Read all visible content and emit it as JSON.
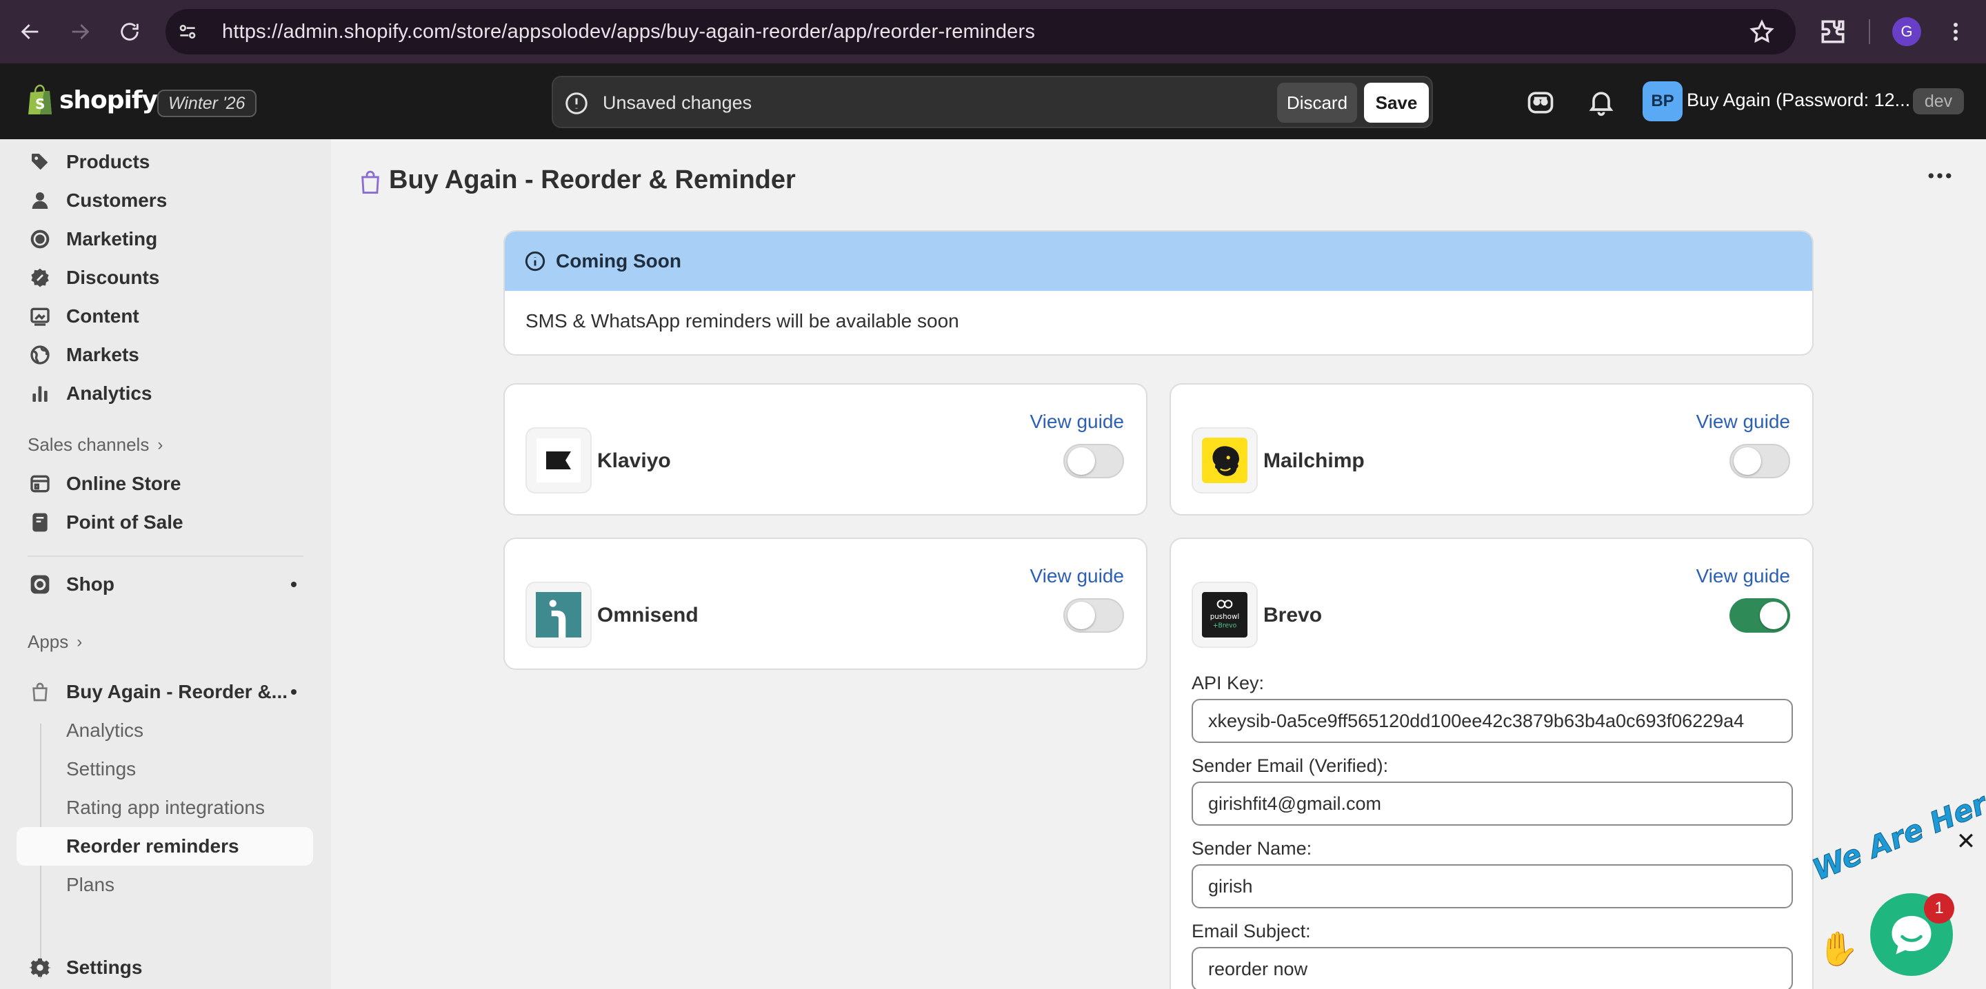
{
  "browser": {
    "url": "https://admin.shopify.com/store/appsolodev/apps/buy-again-reorder/app/reorder-reminders",
    "profile_initial": "G"
  },
  "topbar": {
    "brand": "shopify",
    "edition": "Winter '26",
    "unsaved_message": "Unsaved changes",
    "discard_label": "Discard",
    "save_label": "Save",
    "store_initials": "BP",
    "store_name": "Buy Again (Password: 12...",
    "env_badge": "dev"
  },
  "sidebar": {
    "items": [
      {
        "label": "Products",
        "icon": "tag-icon"
      },
      {
        "label": "Customers",
        "icon": "person-icon"
      },
      {
        "label": "Marketing",
        "icon": "target-icon"
      },
      {
        "label": "Discounts",
        "icon": "discount-icon"
      },
      {
        "label": "Content",
        "icon": "image-icon"
      },
      {
        "label": "Markets",
        "icon": "globe-icon"
      },
      {
        "label": "Analytics",
        "icon": "bar-chart-icon"
      }
    ],
    "sales_channels_label": "Sales channels",
    "channels": [
      {
        "label": "Online Store",
        "icon": "store-icon"
      },
      {
        "label": "Point of Sale",
        "icon": "pos-icon"
      }
    ],
    "shop_label": "Shop",
    "apps_label": "Apps",
    "app_name": "Buy Again - Reorder &...",
    "app_subitems": [
      "Analytics",
      "Settings",
      "Rating app integrations",
      "Reorder reminders",
      "Plans"
    ],
    "settings_label": "Settings"
  },
  "page": {
    "title": "Buy Again - Reorder & Reminder",
    "banner": {
      "heading": "Coming Soon",
      "body": "SMS & WhatsApp reminders will be available soon"
    },
    "integrations": [
      {
        "name": "Klaviyo",
        "guide": "View guide",
        "enabled": false
      },
      {
        "name": "Mailchimp",
        "guide": "View guide",
        "enabled": false
      },
      {
        "name": "Omnisend",
        "guide": "View guide",
        "enabled": false
      },
      {
        "name": "Brevo",
        "guide": "View guide",
        "enabled": true
      }
    ],
    "brevo_form": {
      "api_key_label": "API Key:",
      "api_key_value": "xkeysib-0a5ce9ff565120dd100ee42c3879b63b4a0c693f06229a4",
      "sender_email_label": "Sender Email (Verified):",
      "sender_email_value": "girishfit4@gmail.com",
      "sender_name_label": "Sender Name:",
      "sender_name_value": "girish",
      "email_subject_label": "Email Subject:",
      "email_subject_value": "reorder now"
    }
  },
  "chat_widget": {
    "tagline": "We Are Here!",
    "unread_count": "1",
    "close_glyph": "✕"
  },
  "colors": {
    "accent_link": "#2c5fb8",
    "toggle_on": "#2e8b57",
    "banner_bg": "#a8d0f7",
    "chat_green": "#1fb67f"
  }
}
